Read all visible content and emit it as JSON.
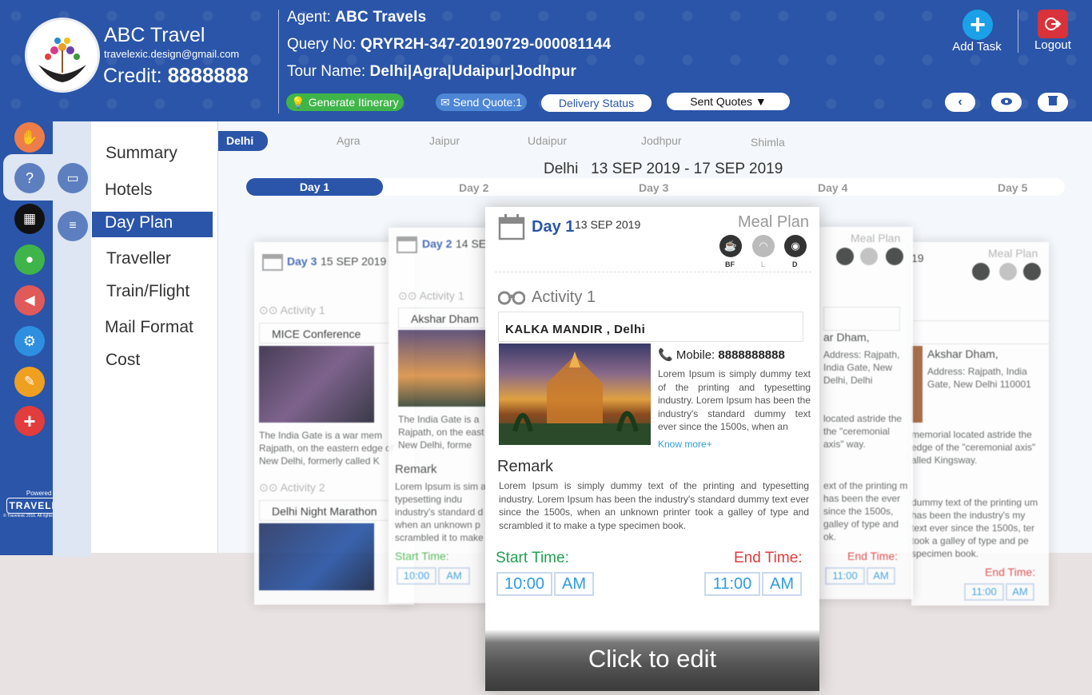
{
  "brand": {
    "name": "ABC Travel",
    "email": "travelexic.design@gmail.com",
    "credit_label": "Credit:",
    "credit_value": "8888888"
  },
  "query": {
    "agent_label": "Agent:",
    "agent_value": "ABC Travels",
    "query_label": "Query No:",
    "query_value": "QRYR2H-347-20190729-000081144",
    "tour_label": "Tour Name:",
    "tour_value": "Delhi|Agra|Udaipur|Jodhpur"
  },
  "actions": {
    "generate_itinerary": "Generate Itinerary",
    "send_quote": "Send Quote:1",
    "delivery_status": "Delivery Status",
    "sent_quotes": "Sent Quotes",
    "add_task": "Add Task",
    "logout": "Logout"
  },
  "menu": [
    "Summary",
    "Hotels",
    "Day Plan",
    "Traveller",
    "Train/Flight",
    "Mail Format",
    "Cost"
  ],
  "powered": {
    "by": "Powered by",
    "brand": "TRAVELEXIC",
    "copyright": "© Travelexic 2016. All rights reserved."
  },
  "cities": [
    "Delhi",
    "Agra",
    "Jaipur",
    "Udaipur",
    "Jodhpur",
    "Shimla"
  ],
  "range": {
    "city": "Delhi",
    "dates": "13 SEP 2019 - 17 SEP 2019"
  },
  "days": [
    "Day 1",
    "Day 2",
    "Day 3",
    "Day 4",
    "Day 5"
  ],
  "main_card": {
    "day": "Day 1",
    "date": "13 SEP 2019",
    "meal_plan": "Meal Plan",
    "meals": [
      "BF",
      "L",
      "D"
    ],
    "activity": "Activity 1",
    "place": "KALKA MANDIR , Delhi",
    "mobile_label": "Mobile:",
    "mobile_value": "8888888888",
    "desc": "Lorem Ipsum is simply dummy text of the printing and typesetting industry. Lorem Ipsum has been the industry's standard dummy text ever since the 1500s, when an",
    "know_more": "Know more+",
    "remark_title": "Remark",
    "remark": "Lorem Ipsum is simply dummy text of the printing and typesetting industry. Lorem Ipsum has been the industry's standard dummy text ever since the 1500s, when an unknown printer took a galley of type and scrambled it to make a type specimen book.",
    "start_label": "Start Time:",
    "start_time": "10:00",
    "start_ampm": "AM",
    "end_label": "End Time:",
    "end_time": "11:00",
    "end_ampm": "AM",
    "edit": "Click to edit"
  },
  "back_cards": {
    "c3": {
      "day": "Day 3",
      "date": "15 SEP 2019",
      "activity1": "Activity 1",
      "place1": "MICE Conference",
      "desc1": "The India Gate is a war mem Rajpath, on the eastern edge of New Delhi, formerly called K",
      "activity2": "Activity 2",
      "place2": "Delhi Night Marathon"
    },
    "c2": {
      "day": "Day 2",
      "date": "14 SE",
      "activity": "Activity 1",
      "place": "Akshar Dham",
      "desc": "The India Gate is a Rajpath, on the east of New Delhi, forme",
      "remark_title": "Remark",
      "remark": "Lorem Ipsum is sim and typesetting indu industry's standard d when an unknown p scrambled it to make",
      "start_label": "Start Time:",
      "start_time": "10:00",
      "ampm": "AM"
    },
    "c4": {
      "meal_plan": "Meal Plan",
      "date_frag": "19",
      "place_frag": "ar Dham,",
      "addr": "Address: Rajpath, India Gate, New Delhi, Delhi",
      "desc": "located astride the the \"ceremonial axis\" way.",
      "remark": "ext of the printing m has been the ever since the 1500s, galley of type and ok.",
      "end_label": "End Time:",
      "end_time": "11:00",
      "ampm": "AM"
    },
    "c5": {
      "meal_plan": "Meal Plan",
      "date_frag": "19",
      "place": "Akshar Dham,",
      "addr": "Address: Rajpath, India Gate, New Delhi 110001",
      "desc": "memorial located astride the edge of the \"ceremonial axis\" alled Kingsway.",
      "remark": "dummy text of the printing um has been the industry's my text ever since the 1500s, ter took a galley of type and pe specimen book.",
      "end_label": "End Time:",
      "end_time": "11:00",
      "ampm": "AM"
    }
  },
  "colors": {
    "header": "#2a55a8",
    "green": "#3fb549",
    "red": "#e03c3c",
    "accent": "#2e9ce0"
  }
}
